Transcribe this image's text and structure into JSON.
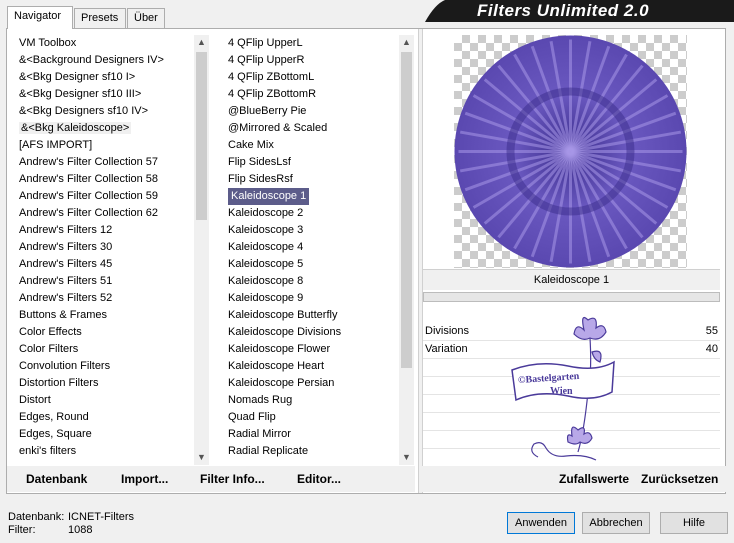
{
  "banner": {
    "title": "Filters Unlimited 2.0"
  },
  "tabs": [
    "Navigator",
    "Presets",
    "Über"
  ],
  "categories": [
    "VM Toolbox",
    "&<Background Designers IV>",
    "&<Bkg Designer sf10 I>",
    "&<Bkg Designer sf10 III>",
    "&<Bkg Designers sf10 IV>",
    "&<Bkg Kaleidoscope>",
    "[AFS IMPORT]",
    "Andrew's Filter Collection 57",
    "Andrew's Filter Collection 58",
    "Andrew's Filter Collection 59",
    "Andrew's Filter Collection 62",
    "Andrew's Filters 12",
    "Andrew's Filters 30",
    "Andrew's Filters 45",
    "Andrew's Filters 51",
    "Andrew's Filters 52",
    "Buttons & Frames",
    "Color Effects",
    "Color Filters",
    "Convolution Filters",
    "Distortion Filters",
    "Distort",
    "Edges, Round",
    "Edges, Square",
    "enki's filters"
  ],
  "filters": [
    "4 QFlip UpperL",
    "4 QFlip UpperR",
    "4 QFlip ZBottomL",
    "4 QFlip ZBottomR",
    "@BlueBerry Pie",
    "@Mirrored & Scaled",
    "Cake Mix",
    "Flip SidesLsf",
    "Flip SidesRsf",
    "Kaleidoscope 1",
    "Kaleidoscope 2",
    "Kaleidoscope 3",
    "Kaleidoscope 4",
    "Kaleidoscope 5",
    "Kaleidoscope 8",
    "Kaleidoscope 9",
    "Kaleidoscope Butterfly",
    "Kaleidoscope Divisions",
    "Kaleidoscope Flower",
    "Kaleidoscope Heart",
    "Kaleidoscope Persian",
    "Nomads Rug",
    "Quad Flip",
    "Radial Mirror",
    "Radial Replicate"
  ],
  "selected_category_index": 5,
  "selected_filter_index": 9,
  "preview": {
    "filter_name": "Kaleidoscope 1",
    "watermark_line1": "©Bastelgarten",
    "watermark_line2": "Wien"
  },
  "params": [
    {
      "name": "Divisions",
      "value": "55"
    },
    {
      "name": "Variation",
      "value": "40"
    }
  ],
  "left_buttons": [
    "Datenbank",
    "Import...",
    "Filter Info...",
    "Editor..."
  ],
  "right_buttons": [
    "Zufallswerte",
    "Zurücksetzen"
  ],
  "status": {
    "db_label": "Datenbank:",
    "db_value": "ICNET-Filters",
    "filter_label": "Filter:",
    "filter_value": "1088"
  },
  "dialog_buttons": {
    "apply": "Anwenden",
    "cancel": "Abbrechen",
    "help": "Hilfe"
  },
  "colors": {
    "accent": "#7060c0",
    "selection": "#5c5c8a"
  }
}
